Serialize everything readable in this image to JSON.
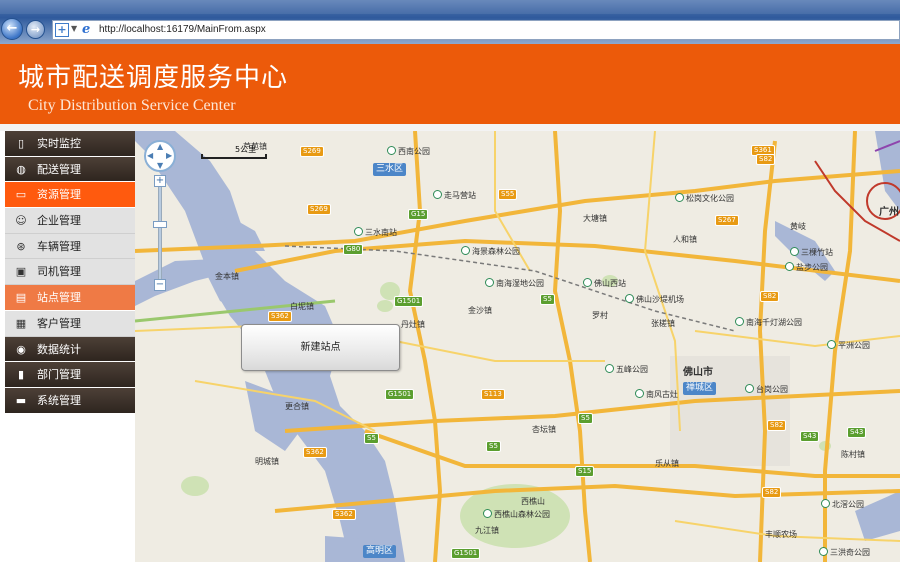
{
  "browser": {
    "address_url": "http://localhost:16179/MainFrom.aspx",
    "back_icon": "back-arrow-icon",
    "forward_icon": "forward-arrow-icon"
  },
  "header": {
    "title": "城市配送调度服务中心",
    "subtitle": "City Distribution Service Center",
    "color": "#ec5a0a"
  },
  "sidebar": {
    "items": [
      {
        "label": "实时监控",
        "level": "top",
        "icon": "monitor-icon"
      },
      {
        "label": "配送管理",
        "level": "top",
        "icon": "globe-icon"
      },
      {
        "label": "资源管理",
        "level": "active",
        "icon": "resource-icon"
      },
      {
        "label": "企业管理",
        "level": "sub",
        "icon": "person-icon"
      },
      {
        "label": "车辆管理",
        "level": "sub",
        "icon": "wheel-icon"
      },
      {
        "label": "司机管理",
        "level": "sub",
        "icon": "driver-icon"
      },
      {
        "label": "站点管理",
        "level": "sub-active",
        "icon": "station-icon"
      },
      {
        "label": "客户管理",
        "level": "sub",
        "icon": "customer-icon"
      },
      {
        "label": "数据统计",
        "level": "top",
        "icon": "disc-icon"
      },
      {
        "label": "部门管理",
        "level": "top",
        "icon": "department-icon"
      },
      {
        "label": "系统管理",
        "level": "top",
        "icon": "system-icon"
      }
    ]
  },
  "map": {
    "create_station_button": "新建站点",
    "scale_label": "5公里",
    "zoom_in": "+",
    "zoom_out": "−",
    "districts": [
      "三水区",
      "禅城区",
      "高明区"
    ],
    "places": [
      {
        "text": "西南公园",
        "poi": true
      },
      {
        "text": "芦苞镇",
        "poi": false
      },
      {
        "text": "走马营站",
        "poi": true
      },
      {
        "text": "松岗文化公园",
        "poi": true
      },
      {
        "text": "三水南站",
        "poi": true
      },
      {
        "text": "大塘镇",
        "poi": false
      },
      {
        "text": "海景森林公园",
        "poi": true
      },
      {
        "text": "人和镇",
        "poi": false
      },
      {
        "text": "黄岐",
        "poi": false
      },
      {
        "text": "三棵竹站",
        "poi": true
      },
      {
        "text": "盐步公园",
        "poi": true
      },
      {
        "text": "金本镇",
        "poi": false
      },
      {
        "text": "南海湿地公园",
        "poi": true
      },
      {
        "text": "佛山西站",
        "poi": true
      },
      {
        "text": "佛山沙堤机场",
        "poi": true
      },
      {
        "text": "白坭镇",
        "poi": false
      },
      {
        "text": "金沙镇",
        "poi": false
      },
      {
        "text": "罗村",
        "poi": false
      },
      {
        "text": "丹灶镇",
        "poi": false
      },
      {
        "text": "张槎镇",
        "poi": false
      },
      {
        "text": "南海千灯湖公园",
        "poi": true
      },
      {
        "text": "平洲公园",
        "poi": true
      },
      {
        "text": "五峰公园",
        "poi": true
      },
      {
        "text": "佛山市",
        "poi": false
      },
      {
        "text": "台岗公园",
        "poi": true
      },
      {
        "text": "更合镇",
        "poi": false
      },
      {
        "text": "南风古灶",
        "poi": true
      },
      {
        "text": "陈村镇",
        "poi": false
      },
      {
        "text": "杏坛镇",
        "poi": false
      },
      {
        "text": "乐从镇",
        "poi": false
      },
      {
        "text": "明城镇",
        "poi": false
      },
      {
        "text": "西樵山",
        "poi": false
      },
      {
        "text": "西樵山森林公园",
        "poi": true
      },
      {
        "text": "北滘公园",
        "poi": true
      },
      {
        "text": "九江镇",
        "poi": false
      },
      {
        "text": "丰顺农场",
        "poi": false
      },
      {
        "text": "三洪奇公园",
        "poi": true
      },
      {
        "text": "广州",
        "poi": false
      }
    ],
    "road_badges": [
      "S269",
      "G15",
      "S55",
      "S361",
      "S82",
      "S269",
      "G80",
      "S267",
      "S5",
      "G1501",
      "S82",
      "S5",
      "G1501",
      "S362",
      "S113",
      "S5",
      "S15",
      "S82",
      "S43",
      "S362",
      "S5",
      "S362",
      "G1501",
      "S82",
      "S43"
    ]
  }
}
